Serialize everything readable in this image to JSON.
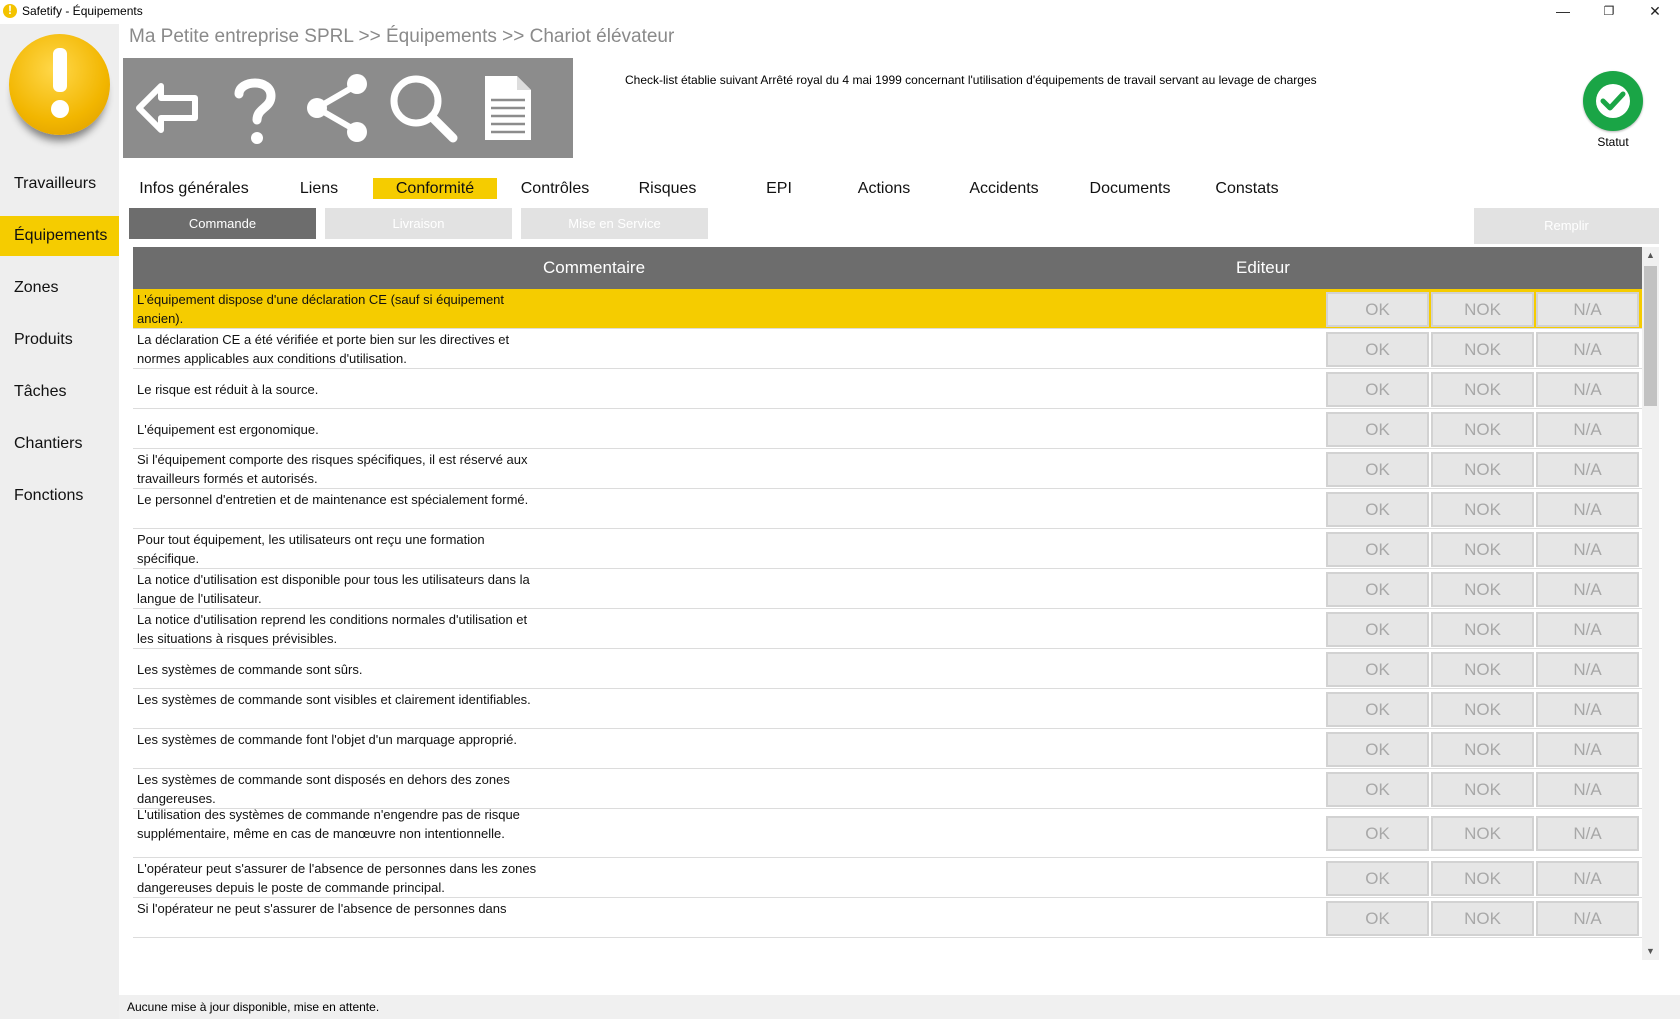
{
  "window": {
    "title": "Safetify - Équipements",
    "minimize": "—",
    "maximize": "❐",
    "close": "✕"
  },
  "sidebar": {
    "items": [
      {
        "label": "Travailleurs"
      },
      {
        "label": "Équipements"
      },
      {
        "label": "Zones"
      },
      {
        "label": "Produits"
      },
      {
        "label": "Tâches"
      },
      {
        "label": "Chantiers"
      },
      {
        "label": "Fonctions"
      }
    ],
    "active": "Équipements"
  },
  "breadcrumb": "Ma Petite entreprise SPRL >> Équipements >> Chariot élévateur",
  "toolbar": {
    "icons": [
      "back-arrow-icon",
      "help-question-icon",
      "share-icon",
      "search-icon",
      "document-icon"
    ]
  },
  "checklist_note": "Check-list établie suivant Arrêté royal du 4 mai 1999 concernant l'utilisation d'équipements de travail servant au levage de charges",
  "statut": {
    "label": "Statut",
    "color": "#1aa546",
    "icon": "check-circle-icon"
  },
  "tabs": [
    {
      "label": "Infos générales"
    },
    {
      "label": "Liens"
    },
    {
      "label": "Conformité"
    },
    {
      "label": "Contrôles"
    },
    {
      "label": "Risques"
    },
    {
      "label": "EPI"
    },
    {
      "label": "Actions"
    },
    {
      "label": "Accidents"
    },
    {
      "label": "Documents"
    },
    {
      "label": "Constats"
    }
  ],
  "active_tab": "Conformité",
  "subtabs": [
    {
      "label": "Commande"
    },
    {
      "label": "Livraison"
    },
    {
      "label": "Mise en Service"
    }
  ],
  "active_subtab": "Commande",
  "remplir_label": "Remplir",
  "table": {
    "headers": {
      "comment": "Commentaire",
      "editor": "Editeur"
    },
    "options": [
      "OK",
      "NOK",
      "N/A"
    ],
    "rows": [
      {
        "text": "L'équipement dispose d'une déclaration CE (sauf si équipement ancien)."
      },
      {
        "text": "La déclaration CE a été vérifiée et porte bien sur les directives et normes applicables aux conditions d'utilisation."
      },
      {
        "text": "Le risque est réduit à la source."
      },
      {
        "text": "L'équipement est ergonomique."
      },
      {
        "text": "Si l'équipement comporte des risques spécifiques, il est réservé aux travailleurs formés et autorisés."
      },
      {
        "text": "Le personnel d'entretien et de maintenance est spécialement formé."
      },
      {
        "text": "Pour tout équipement, les utilisateurs ont reçu une formation spécifique."
      },
      {
        "text": "La notice d'utilisation est disponible pour tous les utilisateurs dans la langue de l'utilisateur."
      },
      {
        "text": "La notice d'utilisation reprend les conditions normales d'utilisation et les situations à risques prévisibles."
      },
      {
        "text": "Les systèmes de commande sont sûrs."
      },
      {
        "text": "Les systèmes de commande sont visibles et clairement identifiables."
      },
      {
        "text": "Les systèmes de commande font l'objet d'un marquage approprié."
      },
      {
        "text": "Les systèmes de commande sont disposés en dehors des zones dangereuses."
      },
      {
        "text": "L'utilisation des systèmes de commande n'engendre pas de risque supplémentaire, même en cas de manœuvre non intentionnelle."
      },
      {
        "text": "L'opérateur peut s'assurer de l'absence de personnes dans les zones dangereuses depuis le poste de commande principal."
      },
      {
        "text": "Si l'opérateur ne peut s'assurer de l'absence de personnes dans"
      }
    ]
  },
  "status_bar": "Aucune mise à jour disponible, mise en attente."
}
